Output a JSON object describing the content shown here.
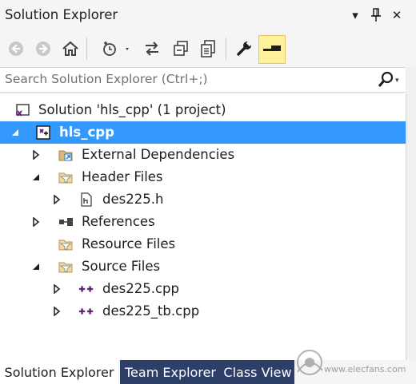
{
  "window": {
    "title": "Solution Explorer",
    "dropdown_glyph": "▾",
    "pin_glyph": "⊥",
    "close_glyph": "✕"
  },
  "toolbar": {
    "buttons": [
      {
        "name": "back-button",
        "icon": "back-arrow-icon"
      },
      {
        "name": "forward-button",
        "icon": "forward-arrow-icon"
      },
      {
        "name": "home-button",
        "icon": "home-icon"
      },
      {
        "name": "pending-changes-filter-button",
        "icon": "clock-filter-icon"
      },
      {
        "name": "sync-with-active-document-button",
        "icon": "sync-arrows-icon"
      },
      {
        "name": "collapse-all-button",
        "icon": "collapse-all-icon"
      },
      {
        "name": "show-all-files-button",
        "icon": "show-all-files-icon"
      },
      {
        "name": "properties-button",
        "icon": "wrench-icon"
      },
      {
        "name": "preview-selected-items-button",
        "icon": "preview-icon",
        "active": true
      }
    ]
  },
  "search": {
    "placeholder": "Search Solution Explorer (Ctrl+;)"
  },
  "tree": {
    "items": [
      {
        "label": "Solution 'hls_cpp' (1 project)",
        "icon": "solution-icon",
        "expander": "none",
        "level": 0
      },
      {
        "label": "hls_cpp",
        "icon": "project-icon",
        "expander": "expanded",
        "level": 0,
        "selected": true
      },
      {
        "label": "External Dependencies",
        "icon": "external-dependencies-folder-icon",
        "expander": "collapsed",
        "level": 1
      },
      {
        "label": "Header Files",
        "icon": "filter-folder-icon",
        "expander": "expanded",
        "level": 1
      },
      {
        "label": "des225.h",
        "icon": "header-file-icon",
        "expander": "collapsed",
        "level": 2
      },
      {
        "label": "References",
        "icon": "references-icon",
        "expander": "collapsed",
        "level": 1
      },
      {
        "label": "Resource Files",
        "icon": "filter-folder-icon",
        "expander": "none",
        "level": 1
      },
      {
        "label": "Source Files",
        "icon": "filter-folder-icon",
        "expander": "expanded",
        "level": 1
      },
      {
        "label": "des225.cpp",
        "icon": "cpp-file-icon",
        "expander": "collapsed",
        "level": 2
      },
      {
        "label": "des225_tb.cpp",
        "icon": "cpp-file-icon",
        "expander": "collapsed",
        "level": 2
      }
    ]
  },
  "bottom_tabs": [
    {
      "label": "Solution Explorer",
      "active": true
    },
    {
      "label": "Team Explorer",
      "active": false
    },
    {
      "label": "Class View",
      "active": false
    }
  ],
  "watermark": {
    "text": "www.elecfans.com"
  },
  "colors": {
    "selection": "#3399ff",
    "tab_inactive": "#2d3e67",
    "accent_yellow": "#fff29d",
    "vs_purple": "#68217a"
  }
}
